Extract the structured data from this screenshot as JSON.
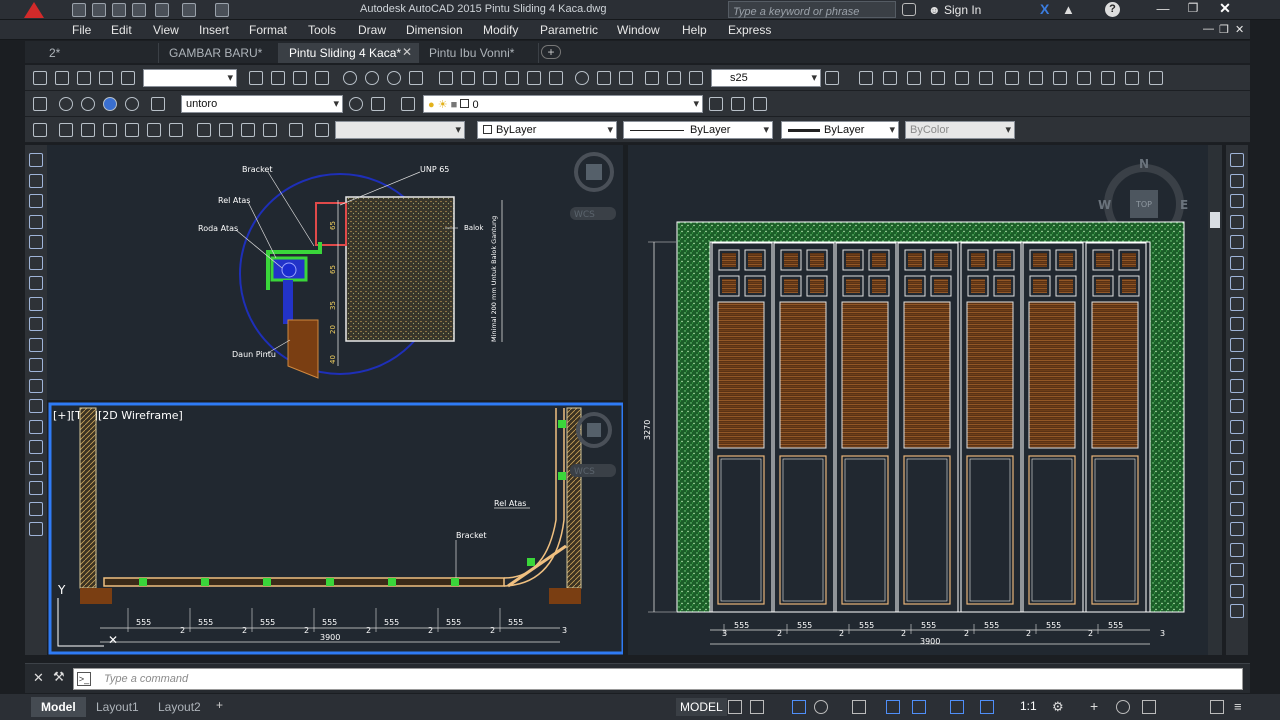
{
  "titlebar": {
    "title": "Autodesk AutoCAD 2015    Pintu Sliding 4 Kaca.dwg",
    "search_placeholder": "Type a keyword or phrase",
    "sign_in": "Sign In"
  },
  "menu": [
    "File",
    "Edit",
    "View",
    "Insert",
    "Format",
    "Tools",
    "Draw",
    "Dimension",
    "Modify",
    "Parametric",
    "Window",
    "Help",
    "Express"
  ],
  "tabs": [
    {
      "label": "2*",
      "active": false
    },
    {
      "label": "GAMBAR BARU*",
      "active": false
    },
    {
      "label": "Pintu Sliding 4 Kaca*",
      "active": true
    },
    {
      "label": "Pintu Ibu Vonni*",
      "active": false
    }
  ],
  "toolbar": {
    "dimstyle": "s25",
    "layer_name": "untoro",
    "layer_state": "0",
    "color": "ByLayer",
    "linetype": "ByLayer",
    "lineweight": "ByLayer",
    "plotstyle": "ByColor"
  },
  "viewport_top_left": {
    "labels": {
      "bracket": "Bracket",
      "rel_atas": "Rel Atas",
      "roda_atas": "Roda Atas",
      "daun_pintu": "Daun Pintu",
      "unp": "UNP 65",
      "balok": "Balok",
      "minimal_note": "Minimal 200 mm Untuk Balok Gantung"
    },
    "dims": [
      "65",
      "65",
      "35",
      "20",
      "40"
    ],
    "wcs": "WCS"
  },
  "viewport_bottom_left": {
    "view_label": "[+][Top][2D Wireframe]",
    "labels": {
      "rel_atas": "Rel Atas",
      "bracket": "Bracket"
    },
    "dim_555": "555",
    "dim_2": "2",
    "dim_3": "3",
    "dim_total": "3900",
    "wcs": "WCS",
    "axis_y": "Y"
  },
  "viewport_right": {
    "compass": {
      "n": "N",
      "w": "W",
      "e": "E",
      "top": "TOP"
    },
    "dim_height": "3270",
    "dim_555": "555",
    "dim_2": "2",
    "dim_3": "3",
    "dim_total": "3900"
  },
  "command": {
    "placeholder": "Type a command"
  },
  "layouts": [
    "Model",
    "Layout1",
    "Layout2"
  ],
  "status": {
    "model": "MODEL",
    "scale": "1:1"
  },
  "colors": {
    "accent_blue": "#2f7bf5",
    "bg_model": "#212830",
    "hatch_green": "#1b8a2e",
    "wood": "#7a3e12"
  }
}
